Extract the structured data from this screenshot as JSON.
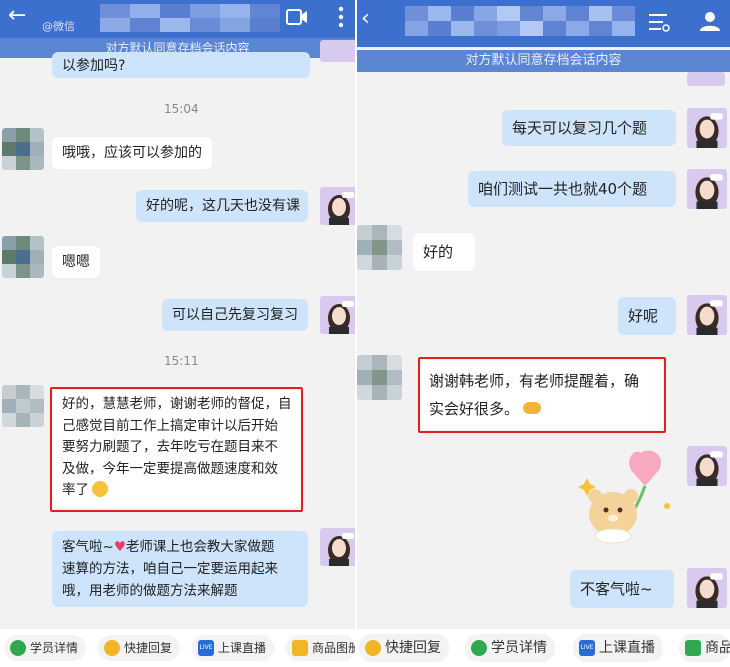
{
  "left": {
    "notice": "对方默认同意存档会话内容",
    "header_subtitle": "@微信",
    "messages": [
      {
        "dir": "out",
        "text": "以参加吗?"
      },
      {
        "time": "15:04"
      },
      {
        "dir": "in",
        "text": "哦哦，应该可以参加的"
      },
      {
        "dir": "out",
        "text": "好的呢，这几天也没有课"
      },
      {
        "dir": "in",
        "text": "嗯嗯"
      },
      {
        "dir": "out",
        "text": "可以自己先复习复习"
      },
      {
        "time": "15:11"
      },
      {
        "dir": "in",
        "lines": [
          "好的，慧慧老师，谢谢老师的督促，自",
          "己感觉目前工作上搞定审计以后开始",
          "要努力刷题了，去年吃亏在题目来不",
          "及做，今年一定要提高做题速度和效",
          "率了"
        ]
      },
      {
        "dir": "out",
        "lines": [
          "客气啦~",
          "老师课上也会教大家做题",
          "速算的方法，咱自己一定要运用起来",
          "哦，用老师的做题方法来解题"
        ]
      }
    ],
    "toolbar": [
      "学员详情",
      "快捷回复",
      "上课直播",
      "商品图册"
    ]
  },
  "right": {
    "notice": "对方默认同意存档会话内容",
    "messages": [
      {
        "dir": "out",
        "text": "每天可以复习几个题"
      },
      {
        "dir": "out",
        "text": "咱们测试一共也就40个题"
      },
      {
        "dir": "in",
        "text": "好的"
      },
      {
        "dir": "out",
        "text": "好呢"
      },
      {
        "dir": "in",
        "lines": [
          "谢谢韩老师，有老师提醒着，确",
          "实会好很多。"
        ]
      },
      {
        "dir": "out",
        "text": "不客气啦~"
      }
    ],
    "toolbar": [
      "快捷回复",
      "学员详情",
      "上课直播",
      "商品"
    ]
  },
  "colors": {
    "header": "#3d6fcf",
    "notice": "#5b86d4",
    "out_bubble": "#cde4fb",
    "in_bubble": "#ffffff",
    "highlight": "#e02020"
  },
  "icons": {
    "live_badge": "LIVE"
  }
}
